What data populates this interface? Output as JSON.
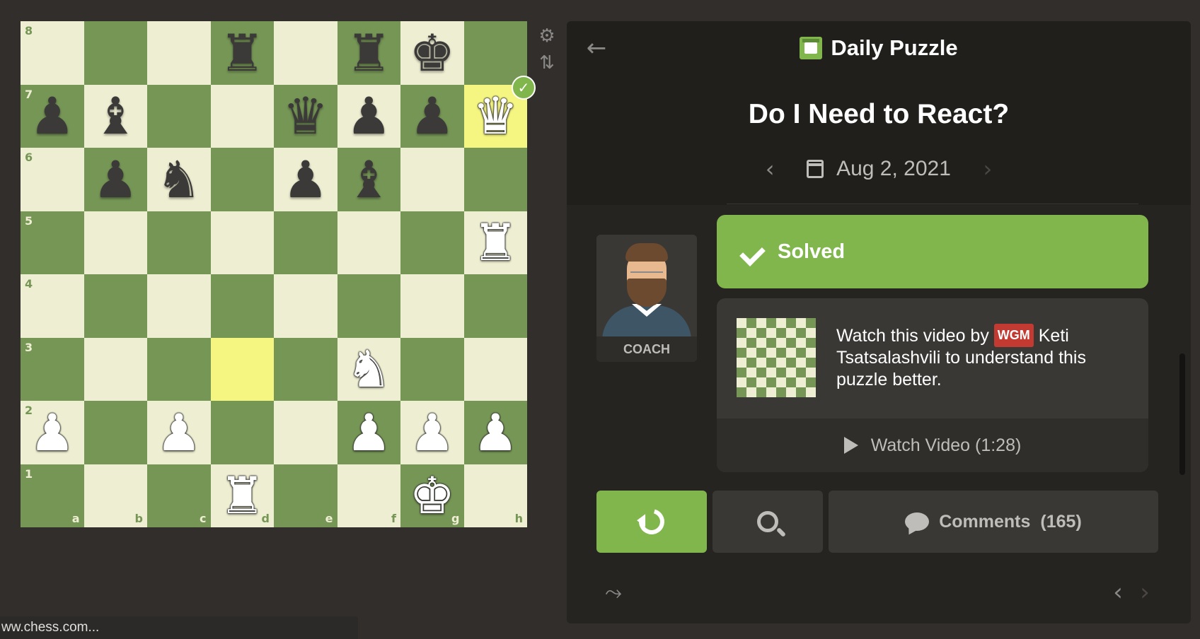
{
  "board": {
    "ranks": [
      "8",
      "7",
      "6",
      "5",
      "4",
      "3",
      "2",
      "1"
    ],
    "files": [
      "a",
      "b",
      "c",
      "d",
      "e",
      "f",
      "g",
      "h"
    ],
    "highlights": [
      "h7",
      "d3"
    ],
    "pieces": {
      "d8": {
        "color": "b",
        "type": "rook",
        "glyph": "♜"
      },
      "f8": {
        "color": "b",
        "type": "rook",
        "glyph": "♜"
      },
      "g8": {
        "color": "b",
        "type": "king",
        "glyph": "♚"
      },
      "a7": {
        "color": "b",
        "type": "pawn",
        "glyph": "♟"
      },
      "b7": {
        "color": "b",
        "type": "bishop",
        "glyph": "♝"
      },
      "e7": {
        "color": "b",
        "type": "queen",
        "glyph": "♛"
      },
      "f7": {
        "color": "b",
        "type": "pawn",
        "glyph": "♟"
      },
      "g7": {
        "color": "b",
        "type": "pawn",
        "glyph": "♟"
      },
      "h7": {
        "color": "w",
        "type": "queen",
        "glyph": "♛"
      },
      "b6": {
        "color": "b",
        "type": "pawn",
        "glyph": "♟"
      },
      "c6": {
        "color": "b",
        "type": "knight",
        "glyph": "♞"
      },
      "e6": {
        "color": "b",
        "type": "pawn",
        "glyph": "♟"
      },
      "f6": {
        "color": "b",
        "type": "bishop",
        "glyph": "♝"
      },
      "h5": {
        "color": "w",
        "type": "rook",
        "glyph": "♜"
      },
      "f3": {
        "color": "w",
        "type": "knight",
        "glyph": "♞"
      },
      "a2": {
        "color": "w",
        "type": "pawn",
        "glyph": "♟"
      },
      "c2": {
        "color": "w",
        "type": "pawn",
        "glyph": "♟"
      },
      "f2": {
        "color": "w",
        "type": "pawn",
        "glyph": "♟"
      },
      "g2": {
        "color": "w",
        "type": "pawn",
        "glyph": "♟"
      },
      "h2": {
        "color": "w",
        "type": "pawn",
        "glyph": "♟"
      },
      "d1": {
        "color": "w",
        "type": "rook",
        "glyph": "♜"
      },
      "g1": {
        "color": "w",
        "type": "king",
        "glyph": "♚"
      }
    },
    "colors": {
      "light": "#eeeed2",
      "dark": "#769656",
      "highlight": "#f5f682"
    }
  },
  "tools": {
    "settings_icon": "gear-icon",
    "flip_icon": "flip-board-icon"
  },
  "header": {
    "back_icon": "arrow-left-icon",
    "icon": "daily-puzzle-icon",
    "title": "Daily Puzzle"
  },
  "puzzle": {
    "title": "Do I Need to React?",
    "date": "Aug 2, 2021",
    "prev_icon": "chevron-left-icon",
    "next_icon": "chevron-right-icon"
  },
  "coach": {
    "label": "COACH"
  },
  "result": {
    "status": "Solved",
    "accent": "#81b64c"
  },
  "video": {
    "desc_prefix": "Watch this video by",
    "title_badge": "WGM",
    "desc_suffix": "Keti Tsatsalashvili to understand this puzzle better.",
    "button_label": "Watch Video (1:28)"
  },
  "actions": {
    "retry_icon": "retry-icon",
    "analysis_icon": "analysis-icon",
    "comments_label": "Comments",
    "comments_count": "(165)"
  },
  "footer": {
    "share_icon": "share-icon",
    "prev_icon": "chevron-left-icon",
    "next_icon": "chevron-right-icon"
  },
  "status_bar": {
    "text": "ww.chess.com..."
  }
}
